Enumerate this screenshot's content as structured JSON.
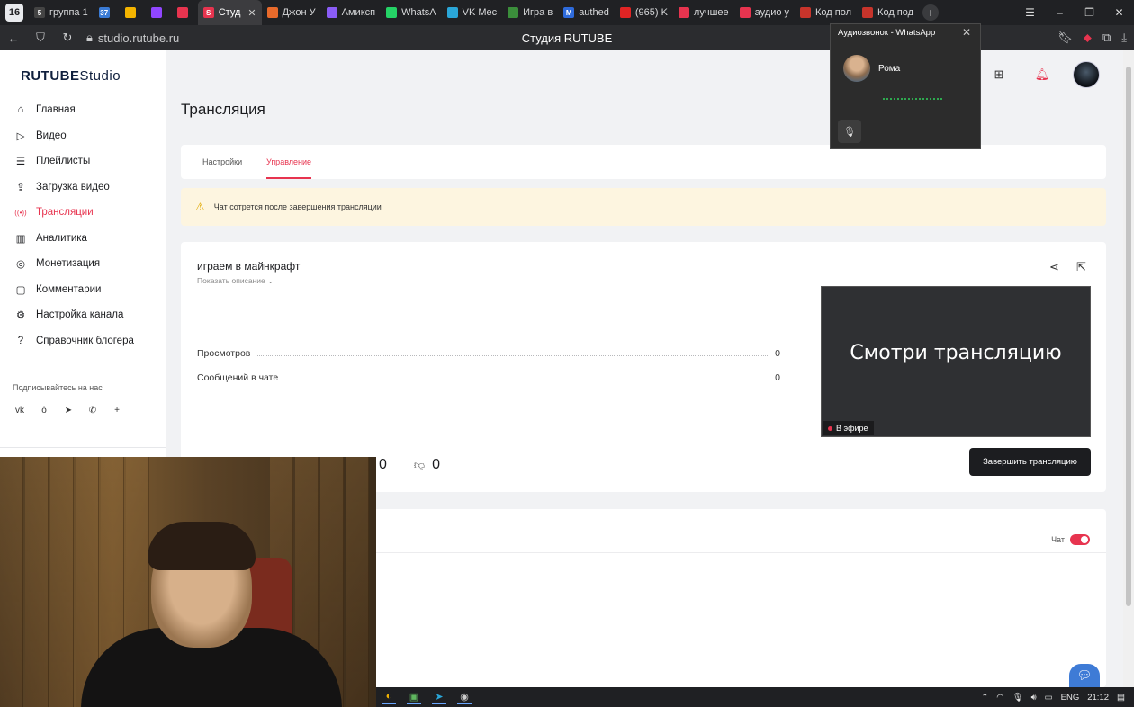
{
  "browser": {
    "tab_count": "16",
    "tabs": [
      {
        "label": "группа 1",
        "badge": "5",
        "color": "#444"
      },
      {
        "label": "",
        "badge": "37",
        "color": "#3a7bd5"
      },
      {
        "label": "",
        "badge": "",
        "color": "#f4b400"
      },
      {
        "label": "",
        "badge": "",
        "color": "#9146ff"
      },
      {
        "label": "",
        "badge": "",
        "color": "#e7344f"
      },
      {
        "label": "Студ",
        "badge": "S",
        "color": "#e7344f"
      },
      {
        "label": "Джон У",
        "badge": "",
        "color": "#e86a2b"
      },
      {
        "label": "Амиксп",
        "badge": "",
        "color": "#8a5cf6"
      },
      {
        "label": "WhatsA",
        "badge": "",
        "color": "#25d366"
      },
      {
        "label": "VK Mec",
        "badge": "",
        "color": "#2aa6d8"
      },
      {
        "label": "Игра в",
        "badge": "",
        "color": "#3b8e3b"
      },
      {
        "label": "authed",
        "badge": "M",
        "color": "#2e6bdc"
      },
      {
        "label": "(965) K",
        "badge": "",
        "color": "#e02424"
      },
      {
        "label": "лучшее",
        "badge": "",
        "color": "#e7344f"
      },
      {
        "label": "аудио у",
        "badge": "",
        "color": "#e7344f"
      },
      {
        "label": "Код пол",
        "badge": "",
        "color": "#c7342b"
      },
      {
        "label": "Код под",
        "badge": "",
        "color": "#c7342b"
      }
    ],
    "active_tab_index": 5,
    "url": "studio.rutube.ru",
    "page_title": "Студия RUTUBE"
  },
  "sidebar": {
    "logo_main": "RUTUBE",
    "logo_sub": "Studio",
    "items": [
      {
        "label": "Главная",
        "icon": "home-icon",
        "active": false
      },
      {
        "label": "Видео",
        "icon": "video-icon",
        "active": false
      },
      {
        "label": "Плейлисты",
        "icon": "playlist-icon",
        "active": false
      },
      {
        "label": "Загрузка видео",
        "icon": "upload-icon",
        "active": false
      },
      {
        "label": "Трансляции",
        "icon": "broadcast-icon",
        "active": true
      },
      {
        "label": "Аналитика",
        "icon": "analytics-icon",
        "active": false
      },
      {
        "label": "Монетизация",
        "icon": "money-icon",
        "active": false
      },
      {
        "label": "Комментарии",
        "icon": "comments-icon",
        "active": false
      },
      {
        "label": "Настройка канала",
        "icon": "settings-icon",
        "active": false
      },
      {
        "label": "Справочник блогера",
        "icon": "handbook-icon",
        "active": false
      }
    ],
    "follow_label": "Подписывайтесь на нас",
    "socials": [
      "vk-icon",
      "ok-icon",
      "telegram-icon",
      "viber-icon",
      "plus-icon"
    ]
  },
  "main": {
    "title": "Трансляция",
    "tabs": [
      {
        "label": "Настройки",
        "active": false
      },
      {
        "label": "Управление",
        "active": true
      }
    ],
    "alert_text": "Чат сотрется после завершения трансляции",
    "stream": {
      "title": "играем в майнкрафт",
      "show_description": "Показать описание",
      "stats": [
        {
          "label": "Просмотров",
          "value": "0"
        },
        {
          "label": "Сообщений в чате",
          "value": "0"
        }
      ],
      "preview_text": "Смотри трансляцию",
      "live_label": "В эфире",
      "likes": "0",
      "dislikes": "0",
      "end_button": "Завершить трансляцию"
    },
    "chat_toggle_label": "Чат",
    "chat_enabled": true
  },
  "whatsapp_call": {
    "title": "Аудиозвонок - WhatsApp",
    "contact": "Рома"
  },
  "taskbar": {
    "language": "ENG",
    "time": "21:12"
  },
  "colors": {
    "accent": "#e7344f",
    "dark_button": "#1c1d20",
    "alert_bg": "#fdf5e0"
  }
}
